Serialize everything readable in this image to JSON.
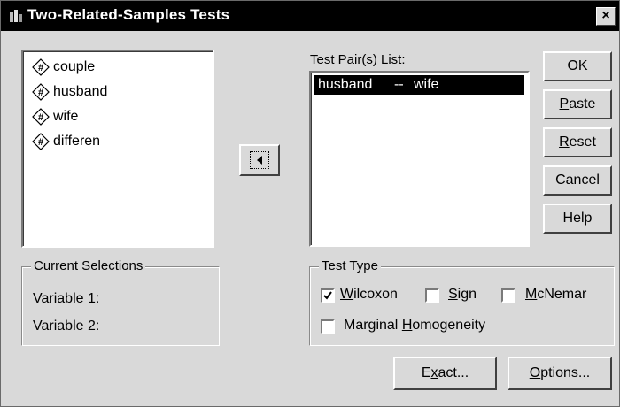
{
  "window": {
    "title": "Two-Related-Samples Tests",
    "close_glyph": "×"
  },
  "variables": [
    {
      "name": "couple",
      "icon": "numeric-variable-icon"
    },
    {
      "name": "husband",
      "icon": "numeric-variable-icon"
    },
    {
      "name": "wife",
      "icon": "numeric-variable-icon"
    },
    {
      "name": "differen",
      "icon": "numeric-variable-icon"
    }
  ],
  "move_button": {
    "icon": "left-arrow-icon"
  },
  "test_pairs": {
    "label_underlined": "T",
    "label_rest": "est Pair(s) List:",
    "pairs": [
      {
        "first": "husband",
        "separator": "--",
        "second": "wife"
      }
    ]
  },
  "buttons": {
    "ok": "OK",
    "paste_u": "P",
    "paste_rest": "aste",
    "reset_u": "R",
    "reset_rest": "eset",
    "cancel": "Cancel",
    "help": "Help",
    "exact_pre": "E",
    "exact_u": "x",
    "exact_rest": "act...",
    "options_u": "O",
    "options_rest": "ptions..."
  },
  "current_selections": {
    "title": "Current Selections",
    "variable1": "Variable 1:",
    "variable2": "Variable 2:"
  },
  "test_type": {
    "title": "Test Type",
    "wilcoxon": {
      "u": "W",
      "rest": "ilcoxon",
      "checked": true
    },
    "sign": {
      "u": "S",
      "rest": "ign",
      "checked": false
    },
    "mcnemar": {
      "u": "M",
      "rest": "cNemar",
      "checked": false
    },
    "marginal": {
      "pre": "Marginal ",
      "u": "H",
      "rest": "omogeneity",
      "checked": false
    }
  }
}
